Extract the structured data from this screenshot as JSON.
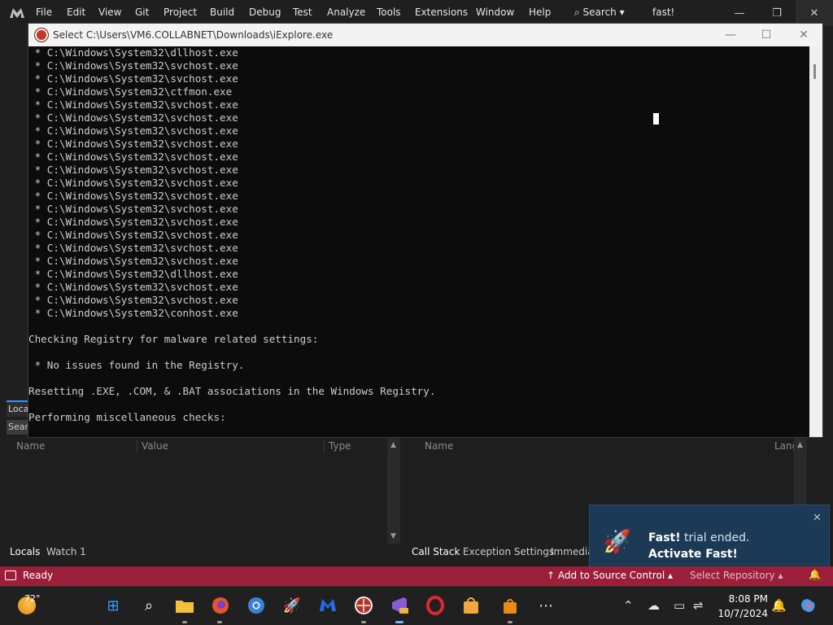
{
  "vs": {
    "menu": [
      "File",
      "Edit",
      "View",
      "Git",
      "Project",
      "Build",
      "Debug",
      "Test",
      "Analyze",
      "Tools",
      "Extensions",
      "Window",
      "Help"
    ],
    "search_label": "Search",
    "solution_name": "fast!",
    "minimize": "—",
    "restore": "❐",
    "close": "✕"
  },
  "console": {
    "title": "Select C:\\Users\\VM6.COLLABNET\\Downloads\\iExplore.exe",
    "minimize": "—",
    "maximize": "☐",
    "close": "✕",
    "lines": [
      " * C:\\Windows\\System32\\dllhost.exe",
      " * C:\\Windows\\System32\\svchost.exe",
      " * C:\\Windows\\System32\\svchost.exe",
      " * C:\\Windows\\System32\\ctfmon.exe",
      " * C:\\Windows\\System32\\svchost.exe",
      " * C:\\Windows\\System32\\svchost.exe",
      " * C:\\Windows\\System32\\svchost.exe",
      " * C:\\Windows\\System32\\svchost.exe",
      " * C:\\Windows\\System32\\svchost.exe",
      " * C:\\Windows\\System32\\svchost.exe",
      " * C:\\Windows\\System32\\svchost.exe",
      " * C:\\Windows\\System32\\svchost.exe",
      " * C:\\Windows\\System32\\svchost.exe",
      " * C:\\Windows\\System32\\svchost.exe",
      " * C:\\Windows\\System32\\svchost.exe",
      " * C:\\Windows\\System32\\svchost.exe",
      " * C:\\Windows\\System32\\svchost.exe",
      " * C:\\Windows\\System32\\dllhost.exe",
      " * C:\\Windows\\System32\\svchost.exe",
      " * C:\\Windows\\System32\\svchost.exe",
      " * C:\\Windows\\System32\\conhost.exe",
      "",
      "Checking Registry for malware related settings:",
      "",
      " * No issues found in the Registry.",
      "",
      "Resetting .EXE, .COM, & .BAT associations in the Windows Registry.",
      "",
      "Performing miscellaneous checks:"
    ]
  },
  "locals": {
    "tab_stub": "Locals",
    "search_stub": "Search",
    "columns": [
      "Name",
      "Value",
      "Type"
    ],
    "tabs": [
      "Locals",
      "Watch 1"
    ]
  },
  "callstack": {
    "columns": [
      "Name",
      "Lang"
    ],
    "tabs": [
      "Call Stack",
      "Exception Settings",
      "Immediate Window"
    ]
  },
  "toast": {
    "close": "✕",
    "brand": "Fast!",
    "line1_rest": " trial ended.",
    "line2": "Activate Fast!"
  },
  "status": {
    "ready": "Ready",
    "add_source": "↑  Add to Source Control  ▴",
    "select_repo": "Select Repository  ▴"
  },
  "taskbar": {
    "temp": "72°",
    "time": "8:08 PM",
    "date": "10/7/2024"
  }
}
